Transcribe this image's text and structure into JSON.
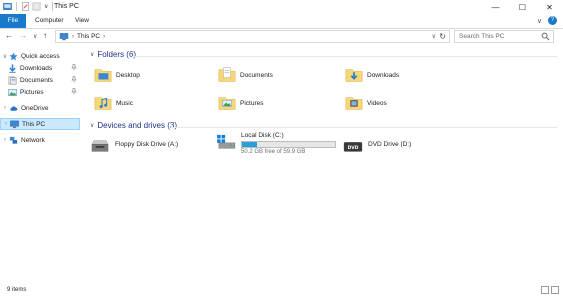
{
  "window": {
    "title": "This PC",
    "minimize": "—",
    "maximize": "☐",
    "close": "✕"
  },
  "quick_access_toolbar": {
    "dropdown": "∨"
  },
  "ribbon": {
    "tabs": [
      {
        "label": "File",
        "active": true
      },
      {
        "label": "Computer"
      },
      {
        "label": "View"
      }
    ],
    "expand": "∨",
    "help": "?"
  },
  "navigation": {
    "back": "←",
    "forward": "→",
    "recent": "∨",
    "up": "↑"
  },
  "address": {
    "crumbs": [
      "This PC"
    ],
    "separator": "›",
    "dropdown": "∨",
    "refresh": "↻"
  },
  "search": {
    "placeholder": "Search This PC"
  },
  "nav_pane": {
    "quick_access": {
      "label": "Quick access",
      "expanded": true
    },
    "quick_items": [
      {
        "label": "Downloads",
        "icon": "download-arrow-icon",
        "pinned": true
      },
      {
        "label": "Documents",
        "icon": "documents-icon",
        "pinned": true
      },
      {
        "label": "Pictures",
        "icon": "pictures-icon",
        "pinned": true
      }
    ],
    "onedrive": {
      "label": "OneDrive"
    },
    "this_pc": {
      "label": "This PC",
      "selected": true
    },
    "network": {
      "label": "Network"
    },
    "pin_glyph": "📌",
    "expand_glyph": "›",
    "collapse_glyph": "∨"
  },
  "content": {
    "folders_header": "Folders (6)",
    "folders": [
      {
        "label": "Desktop",
        "icon": "desktop-folder-icon"
      },
      {
        "label": "Documents",
        "icon": "documents-folder-icon"
      },
      {
        "label": "Downloads",
        "icon": "downloads-folder-icon"
      },
      {
        "label": "Music",
        "icon": "music-folder-icon"
      },
      {
        "label": "Pictures",
        "icon": "pictures-folder-icon"
      },
      {
        "label": "Videos",
        "icon": "videos-folder-icon"
      }
    ],
    "devices_header": "Devices and drives (3)",
    "devices": [
      {
        "label": "Floppy Disk Drive (A:)",
        "icon": "floppy-drive-icon"
      },
      {
        "label": "Local Disk (C:)",
        "icon": "local-disk-icon",
        "free_text": "50.2 GB free of 59.9 GB",
        "used_fraction": 0.16
      },
      {
        "label": "DVD Drive (D:)",
        "icon": "dvd-drive-icon",
        "badge": "DVD"
      }
    ]
  },
  "status": {
    "items": "9 items"
  },
  "colors": {
    "accent": "#1979ca",
    "header_text": "#1e3287",
    "selection": "#cce8ff",
    "folder": "#f8d775",
    "progress": "#26a0da"
  }
}
